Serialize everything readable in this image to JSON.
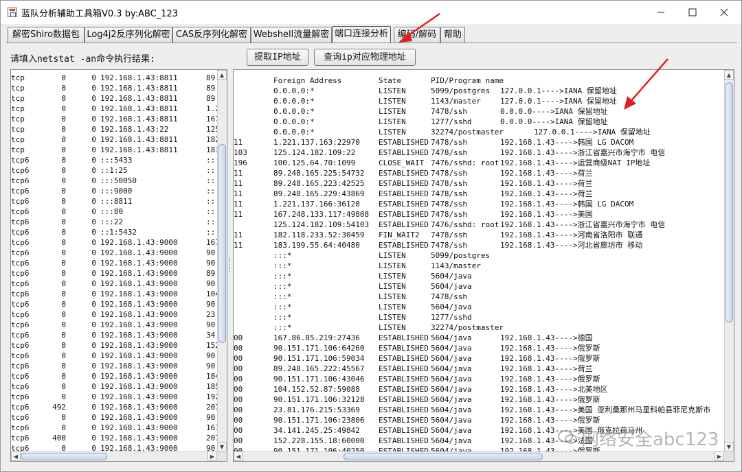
{
  "window": {
    "title": "蓝队分析辅助工具箱V0.3 by:ABC_123"
  },
  "tabs": [
    {
      "label": "解密Shiro数据包",
      "active": false
    },
    {
      "label": "Log4j2反序列化解密",
      "active": false
    },
    {
      "label": "CAS反序列化解密",
      "active": false
    },
    {
      "label": "Webshell流量解密",
      "active": false
    },
    {
      "label": "端口连接分析",
      "active": true
    },
    {
      "label": "编码/解码",
      "active": false
    },
    {
      "label": "帮助",
      "active": false
    }
  ],
  "toolbar": {
    "prompt_label": "请填入netstat -an命令执行结果:",
    "get_ip_button": "提取IP地址",
    "query_location_button": "查询ip对应物理地址"
  },
  "left_rows": [
    [
      "tcp",
      "0",
      "0",
      "192.168.1.43:8811",
      "89."
    ],
    [
      "tcp",
      "0",
      "0",
      "192.168.1.43:8811",
      "89."
    ],
    [
      "tcp",
      "0",
      "0",
      "192.168.1.43:8811",
      "89."
    ],
    [
      "tcp",
      "0",
      "0",
      "192.168.1.43:8811",
      "1.2"
    ],
    [
      "tcp",
      "0",
      "0",
      "192.168.1.43:8811",
      "167"
    ],
    [
      "tcp",
      "0",
      "0",
      "192.168.1.43:22",
      "125"
    ],
    [
      "tcp",
      "0",
      "0",
      "192.168.1.43:8811",
      "182"
    ],
    [
      "tcp",
      "0",
      "0",
      "192.168.1.43:8811",
      "183"
    ],
    [
      "tcp6",
      "0",
      "0",
      ":::5433",
      ":::"
    ],
    [
      "tcp6",
      "0",
      "0",
      "::1:25",
      ":::"
    ],
    [
      "tcp6",
      "0",
      "0",
      ":::50050",
      ":::"
    ],
    [
      "tcp6",
      "0",
      "0",
      ":::9000",
      ":::"
    ],
    [
      "tcp6",
      "0",
      "0",
      ":::8811",
      ":::"
    ],
    [
      "tcp6",
      "0",
      "0",
      ":::80",
      ":::"
    ],
    [
      "tcp6",
      "0",
      "0",
      ":::22",
      ":::"
    ],
    [
      "tcp6",
      "0",
      "0",
      "::1:5432",
      ":::"
    ],
    [
      "tcp6",
      "0",
      "0",
      "192.168.1.43:9000",
      "167"
    ],
    [
      "tcp6",
      "0",
      "0",
      "192.168.1.43:9000",
      "90."
    ],
    [
      "tcp6",
      "0",
      "0",
      "192.168.1.43:9000",
      "90."
    ],
    [
      "tcp6",
      "0",
      "0",
      "192.168.1.43:9000",
      "89."
    ],
    [
      "tcp6",
      "0",
      "0",
      "192.168.1.43:9000",
      "90."
    ],
    [
      "tcp6",
      "0",
      "0",
      "192.168.1.43:9000",
      "104"
    ],
    [
      "tcp6",
      "0",
      "0",
      "192.168.1.43:9000",
      "90."
    ],
    [
      "tcp6",
      "0",
      "0",
      "192.168.1.43:9000",
      "23."
    ],
    [
      "tcp6",
      "0",
      "0",
      "192.168.1.43:9000",
      "90."
    ],
    [
      "tcp6",
      "0",
      "0",
      "192.168.1.43:9000",
      "34."
    ],
    [
      "tcp6",
      "0",
      "0",
      "192.168.1.43:9000",
      "152"
    ],
    [
      "tcp6",
      "0",
      "0",
      "192.168.1.43:9000",
      "90."
    ],
    [
      "tcp6",
      "0",
      "0",
      "192.168.1.43:9000",
      "90."
    ],
    [
      "tcp6",
      "0",
      "0",
      "192.168.1.43:9000",
      "104"
    ],
    [
      "tcp6",
      "0",
      "0",
      "192.168.1.43:9000",
      "185"
    ],
    [
      "tcp6",
      "0",
      "0",
      "192.168.1.43:9000",
      "192"
    ],
    [
      "tcp6",
      "492",
      "0",
      "192.168.1.43:9000",
      "207"
    ],
    [
      "tcp6",
      "0",
      "0",
      "192.168.1.43:9000",
      "90."
    ],
    [
      "tcp6",
      "0",
      "0",
      "192.168.1.43:9000",
      "167"
    ],
    [
      "tcp6",
      "400",
      "0",
      "192.168.1.43:9000",
      "207"
    ],
    [
      "tcp6",
      "0",
      "0",
      "192.168.1.43:9000",
      "90."
    ]
  ],
  "right_header": {
    "foreign": "Foreign Address",
    "state": "State",
    "pid": "PID/Program name"
  },
  "right_rows": [
    {
      "p": "",
      "f": "0.0.0.0:*",
      "s": "LISTEN",
      "g": "5099/postgres",
      "r": "127.0.0.1---->IANA 保留地址",
      "w": "x1"
    },
    {
      "p": "",
      "f": "0.0.0.0:*",
      "s": "LISTEN",
      "g": "1143/master",
      "r": "127.0.0.1---->IANA 保留地址",
      "w": "x1"
    },
    {
      "p": "",
      "f": "0.0.0.0:*",
      "s": "LISTEN",
      "g": "7478/ssh",
      "r": "0.0.0.0---->IANA 保留地址",
      "w": "x1"
    },
    {
      "p": "",
      "f": "0.0.0.0:*",
      "s": "LISTEN",
      "g": "1277/sshd",
      "r": "0.0.0.0---->IANA 保留地址",
      "w": "x1"
    },
    {
      "p": "",
      "f": "0.0.0.0:*",
      "s": "LISTEN",
      "g": "32274/postmaster",
      "r": "127.0.0.1---->IANA 保留地址",
      "w": "x2"
    },
    {
      "p": "11",
      "f": "1.221.137.163:22970",
      "s": "ESTABLISHED",
      "g": "7478/ssh",
      "r": "192.168.1.43---->韩国 LG DACOM",
      "w": "x0"
    },
    {
      "p": "103",
      "f": "125.124.182.109:22",
      "s": "ESTABLISHED",
      "g": "7478/ssh",
      "r": "192.168.1.43---->浙江省嘉兴市海宁市 电信",
      "w": "x0"
    },
    {
      "p": "196",
      "f": "100.125.64.70:1099",
      "s": "CLOSE_WAIT",
      "g": "7476/sshd: root",
      "r": "192.168.1.43---->运营商级NAT IP地址",
      "w": "x0"
    },
    {
      "p": "11",
      "f": "89.248.165.225:54732",
      "s": "ESTABLISHED",
      "g": "7478/ssh",
      "r": "192.168.1.43---->荷兰",
      "w": "x0"
    },
    {
      "p": "11",
      "f": "89.248.165.223:42525",
      "s": "ESTABLISHED",
      "g": "7478/ssh",
      "r": "192.168.1.43---->荷兰",
      "w": "x0"
    },
    {
      "p": "11",
      "f": "89.248.165.229:43869",
      "s": "ESTABLISHED",
      "g": "7478/ssh",
      "r": "192.168.1.43---->荷兰",
      "w": "x0"
    },
    {
      "p": "11",
      "f": "1.221.137.166:36120",
      "s": "ESTABLISHED",
      "g": "7478/ssh",
      "r": "192.168.1.43---->韩国 LG DACOM",
      "w": "x0"
    },
    {
      "p": "11",
      "f": "167.248.133.117:49808",
      "s": "ESTABLISHED",
      "g": "7478/ssh",
      "r": "192.168.1.43---->美国",
      "w": "x0"
    },
    {
      "p": "",
      "f": "125.124.182.109:54103",
      "s": "ESTABLISHED",
      "g": "7476/sshd: root",
      "r": "192.168.1.43---->浙江省嘉兴市海宁市 电信",
      "w": "x0"
    },
    {
      "p": "11",
      "f": "182.118.233.52:30459",
      "s": "FIN_WAIT2",
      "g": "7478/ssh",
      "r": "192.168.1.43---->河南省洛阳市 联通",
      "w": "x0"
    },
    {
      "p": "11",
      "f": "183.199.55.64:40480",
      "s": "ESTABLISHED",
      "g": "7478/ssh",
      "r": "192.168.1.43---->河北省廊坊市 移动",
      "w": "x0"
    },
    {
      "p": "",
      "f": ":::*",
      "s": "LISTEN",
      "g": "5099/postgres",
      "r": "",
      "w": "x0"
    },
    {
      "p": "",
      "f": ":::*",
      "s": "LISTEN",
      "g": "1143/master",
      "r": "",
      "w": "x0"
    },
    {
      "p": "",
      "f": ":::*",
      "s": "LISTEN",
      "g": "5604/java",
      "r": "",
      "w": "x0"
    },
    {
      "p": "",
      "f": ":::*",
      "s": "LISTEN",
      "g": "5604/java",
      "r": "",
      "w": "x0"
    },
    {
      "p": "",
      "f": ":::*",
      "s": "LISTEN",
      "g": "7478/ssh",
      "r": "",
      "w": "x0"
    },
    {
      "p": "",
      "f": ":::*",
      "s": "LISTEN",
      "g": "5604/java",
      "r": "",
      "w": "x0"
    },
    {
      "p": "",
      "f": ":::*",
      "s": "LISTEN",
      "g": "1277/sshd",
      "r": "",
      "w": "x0"
    },
    {
      "p": "",
      "f": ":::*",
      "s": "LISTEN",
      "g": "32274/postmaster",
      "r": "",
      "w": "x0"
    },
    {
      "p": "00",
      "f": "167.86.85.219:27436",
      "s": "ESTABLISHED",
      "g": "5604/java",
      "r": "192.168.1.43---->德国",
      "w": "x0"
    },
    {
      "p": "00",
      "f": "90.151.171.106:64260",
      "s": "ESTABLISHED",
      "g": "5604/java",
      "r": "192.168.1.43---->俄罗斯",
      "w": "x0"
    },
    {
      "p": "00",
      "f": "90.151.171.106:59034",
      "s": "ESTABLISHED",
      "g": "5604/java",
      "r": "192.168.1.43---->俄罗斯",
      "w": "x0"
    },
    {
      "p": "00",
      "f": "89.248.165.222:45567",
      "s": "ESTABLISHED",
      "g": "5604/java",
      "r": "192.168.1.43---->荷兰",
      "w": "x0"
    },
    {
      "p": "00",
      "f": "90.151.171.106:43046",
      "s": "ESTABLISHED",
      "g": "5604/java",
      "r": "192.168.1.43---->俄罗斯",
      "w": "x0"
    },
    {
      "p": "00",
      "f": "104.152.52.87:59088",
      "s": "ESTABLISHED",
      "g": "5604/java",
      "r": "192.168.1.43---->北美地区",
      "w": "x0"
    },
    {
      "p": "00",
      "f": "90.151.171.106:32128",
      "s": "ESTABLISHED",
      "g": "5604/java",
      "r": "192.168.1.43---->俄罗斯",
      "w": "x0"
    },
    {
      "p": "00",
      "f": "23.81.176.215:53369",
      "s": "ESTABLISHED",
      "g": "5604/java",
      "r": "192.168.1.43---->美国 亚利桑那州马里科帕县菲尼克斯市",
      "w": "x0"
    },
    {
      "p": "00",
      "f": "90.151.171.106:23806",
      "s": "ESTABLISHED",
      "g": "5604/java",
      "r": "192.168.1.43---->俄罗斯",
      "w": "x0"
    },
    {
      "p": "00",
      "f": "34.141.245.25:49842",
      "s": "ESTABLISHED",
      "g": "5604/java",
      "r": "192.168.1.43---->美国 俄克拉荷马州",
      "w": "x0"
    },
    {
      "p": "00",
      "f": "152.228.155.18:60000",
      "s": "ESTABLISHED",
      "g": "5604/java",
      "r": "192.168.1.43---->法国",
      "w": "x0"
    },
    {
      "p": "00",
      "f": "90.151.171.106:40250",
      "s": "ESTABLISHED",
      "g": "5604/java",
      "r": "192.168.1.43---->俄罗斯",
      "w": "x0"
    }
  ],
  "watermark": {
    "text": "网络安全abc123"
  },
  "colors": {
    "annotation_arrow": "#e02020",
    "scroll_thumb": "#c9d6e8"
  }
}
